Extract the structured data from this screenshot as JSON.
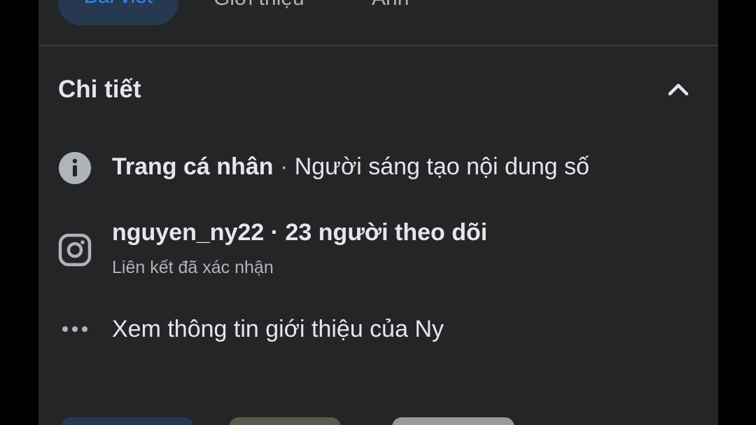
{
  "tabs": [
    {
      "label": "Bài viết",
      "active": true
    },
    {
      "label": "Giới thiệu",
      "active": false
    },
    {
      "label": "Ảnh",
      "active": false
    }
  ],
  "details": {
    "title": "Chi tiết",
    "collapse_icon": "chevron-up-icon",
    "rows": [
      {
        "icon": "info-icon",
        "primary": "Trang cá nhân",
        "separator": " · ",
        "secondary": "Người sáng tạo nội dung số"
      },
      {
        "icon": "instagram-icon",
        "primary": "nguyen_ny22 · 23 người theo dõi",
        "subtitle": "Liên kết đã xác nhận"
      },
      {
        "icon": "more-dots-icon",
        "primary": "Xem thông tin giới thiệu của Ny"
      }
    ]
  },
  "colors": {
    "background": "#242527",
    "text_primary": "#e4e6eb",
    "text_secondary": "#b0b3b8",
    "accent": "#2d88ff",
    "active_tab_bg": "#263951"
  }
}
